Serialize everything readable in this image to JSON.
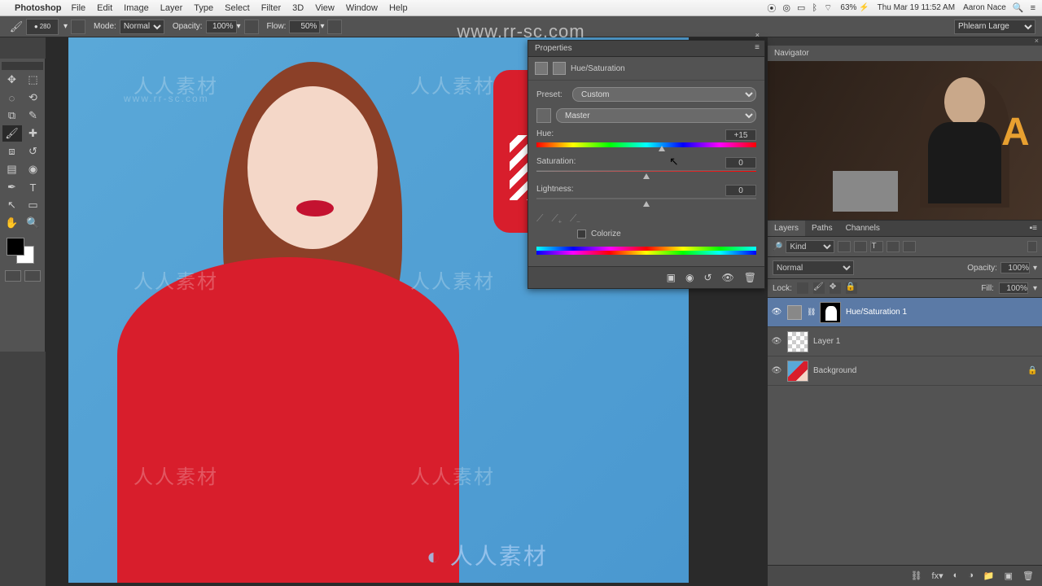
{
  "menubar": {
    "app": "Photoshop",
    "items": [
      "File",
      "Edit",
      "Image",
      "Layer",
      "Type",
      "Select",
      "Filter",
      "3D",
      "View",
      "Window",
      "Help"
    ],
    "battery": "63%",
    "datetime": "Thu Mar 19  11:52 AM",
    "user": "Aaron Nace"
  },
  "options": {
    "brush_size": "280",
    "mode_label": "Mode:",
    "mode_value": "Normal",
    "opacity_label": "Opacity:",
    "opacity_value": "100%",
    "flow_label": "Flow:",
    "flow_value": "50%",
    "workspace": "Phlearn Large"
  },
  "overlay_url": "www.rr-sc.com",
  "watermark_text": "人人素材",
  "watermark_url": "www.rr-sc.com",
  "properties": {
    "panel_title": "Properties",
    "adj_title": "Hue/Saturation",
    "preset_label": "Preset:",
    "preset_value": "Custom",
    "channel_value": "Master",
    "hue_label": "Hue:",
    "hue_value": "+15",
    "sat_label": "Saturation:",
    "sat_value": "0",
    "light_label": "Lightness:",
    "light_value": "0",
    "colorize_label": "Colorize"
  },
  "navigator": {
    "title": "Navigator"
  },
  "layers": {
    "tabs": [
      "Layers",
      "Paths",
      "Channels"
    ],
    "kind_label": "Kind",
    "blend_value": "Normal",
    "opacity_label": "Opacity:",
    "opacity_value": "100%",
    "lock_label": "Lock:",
    "fill_label": "Fill:",
    "fill_value": "100%",
    "items": [
      {
        "name": "Hue/Saturation 1"
      },
      {
        "name": "Layer 1"
      },
      {
        "name": "Background"
      }
    ]
  }
}
